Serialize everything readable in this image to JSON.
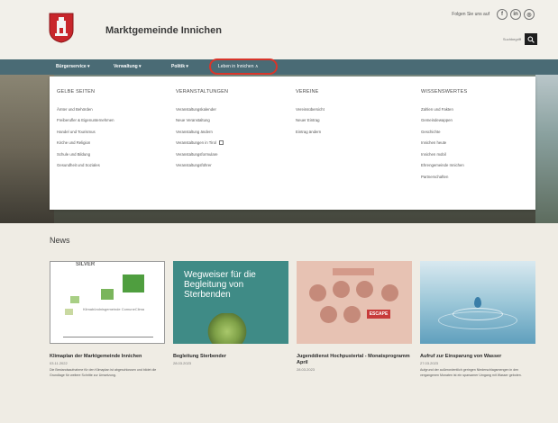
{
  "header": {
    "site_title": "Marktgemeinde Innichen",
    "follow_label": "Folgen Sie uns auf",
    "social": [
      {
        "icon": "facebook-icon",
        "glyph": "f"
      },
      {
        "icon": "linkedin-icon",
        "glyph": "in"
      },
      {
        "icon": "instagram-icon",
        "glyph": "◎"
      }
    ],
    "search_placeholder": "Suchbegriff"
  },
  "nav": {
    "items": [
      {
        "label": "Bürgerservice ▾"
      },
      {
        "label": "Verwaltung ▾"
      },
      {
        "label": "Politik ▾"
      },
      {
        "label": "Leben in Innichen ∧"
      }
    ]
  },
  "mega_menu": {
    "columns": [
      {
        "heading": "GELBE SEITEN",
        "items": [
          "Ämter und Behörden",
          "Freiberufler & Eigenunternehmen",
          "Handel und Tourismus",
          "Kirche und Religion",
          "Schule und Bildung",
          "Gesundheit und Soziales"
        ]
      },
      {
        "heading": "VERANSTALTUNGEN",
        "items": [
          "Veranstaltungskalender",
          "Neue Veranstaltung",
          "Veranstaltung ändern",
          "Veranstaltungen in Tirol",
          "Veranstaltungsformulare",
          "Veranstaltungsführer"
        ]
      },
      {
        "heading": "VEREINE",
        "items": [
          "Vereinsübersicht",
          "Neuer Eintrag",
          "Eintrag ändern"
        ]
      },
      {
        "heading": "WISSENSWERTES",
        "items": [
          "Zahlen und Fakten",
          "Gemeindewappen",
          "Geschichte",
          "Innichen heute",
          "Innichen mobil",
          "Ehrengemeinde Innichen",
          "Partnerschaften"
        ]
      }
    ]
  },
  "news": {
    "title": "News",
    "cards": [
      {
        "title": "Klimaplan der Marktgemeinde Innichen",
        "date": "03.11.2022",
        "text": "Die Bestandsaufnahme für den Klimaplan ist abgeschlossen und bildet die Grundlage für weitere Schritte zur Umsetzung.",
        "image_text_1": "SILVER",
        "image_text_2": "Klimabündnisgemeinde ComuneClima"
      },
      {
        "title": "Begleitung Sterbender",
        "date": "28.03.2023",
        "text": "",
        "image_text": "Wegweiser für die Begleitung von Sterbenden"
      },
      {
        "title": "Jugenddienst Hochpustertal - Monatsprogramm April",
        "date": "28.03.2023",
        "text": "",
        "image_text": "ESCAPE"
      },
      {
        "title": "Aufruf zur Einsparung von Wasser",
        "date": "27.03.2023",
        "text": "Aufgrund der außerordentlich geringen Niederschlagsmengen in den vergangenen Monaten ist ein sparsamer Umgang mit Wasser geboten."
      }
    ]
  },
  "colors": {
    "nav_bg": "#4a6b75",
    "highlight": "#d8352a",
    "page_bg": "#efece4"
  }
}
